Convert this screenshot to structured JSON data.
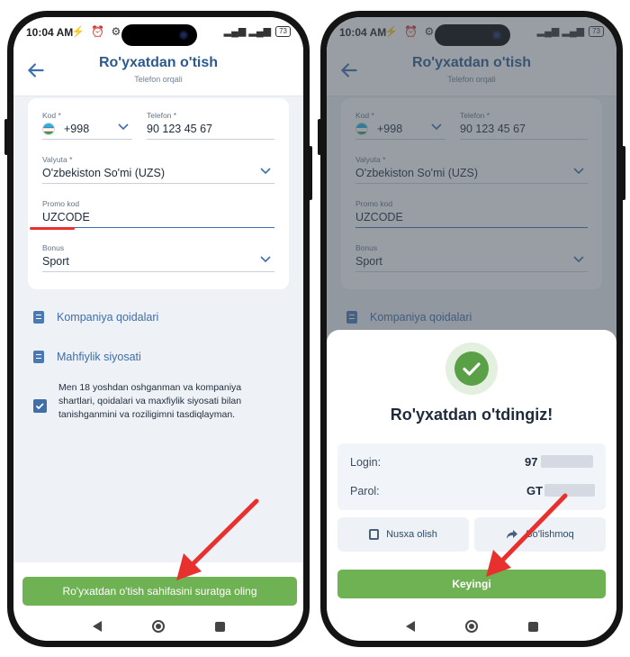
{
  "status_bar": {
    "time": "10:04 AM",
    "left_icons": "⚡ ⏰ ⚙",
    "signal": "▂▄▆ ▂▄▆",
    "battery": "73"
  },
  "header": {
    "title": "Ro'yxatdan o'tish",
    "subtitle": "Telefon orqali"
  },
  "form": {
    "code_label": "Kod *",
    "code_value": "+998",
    "phone_label": "Telefon *",
    "phone_value": "90 123 45 67",
    "currency_label": "Valyuta *",
    "currency_value": "O'zbekiston So'mi (UZS)",
    "promo_label": "Promo kod",
    "promo_value": "UZCODE",
    "bonus_label": "Bonus",
    "bonus_value": "Sport"
  },
  "links": {
    "rules": "Kompaniya qoidalari",
    "privacy": "Mahfiylik siyosati"
  },
  "consent_text": "Men 18 yoshdan oshganman va kompaniya shartlari, qoidalari va maxfiylik siyosati bilan tanishganmini va roziligimni tasdiqlayman.",
  "screenshot_button": "Ro'yxatdan o'tish sahifasini suratga oling",
  "success": {
    "title": "Ro'yxatdan o'tdingiz!",
    "login_label": "Login:",
    "login_value": "97",
    "password_label": "Parol:",
    "password_value": "GT",
    "copy_button": "Nusxa olish",
    "share_button": "Bo'lishmoq",
    "next_button": "Keyingi"
  },
  "colors": {
    "accent_blue": "#2c5a8f",
    "green_button": "#6fb253",
    "success_green": "#5aa046",
    "annotation_red": "#e8312f"
  }
}
